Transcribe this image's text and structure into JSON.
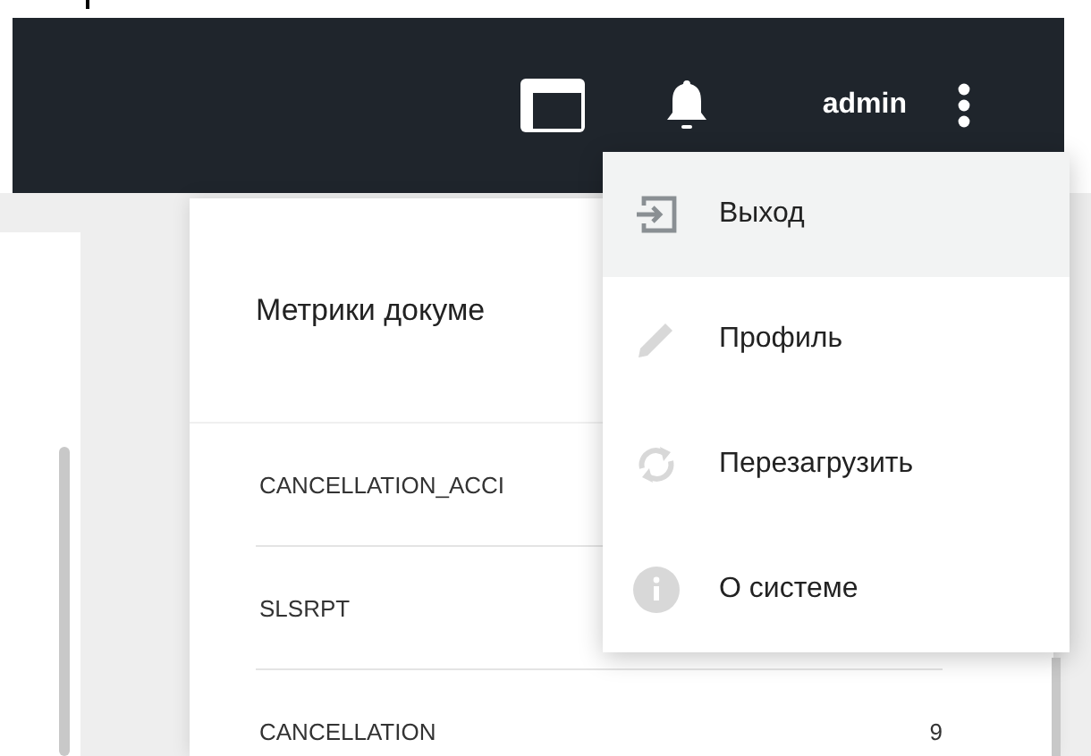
{
  "header": {
    "user": "admin"
  },
  "card": {
    "title": "Метрики докуме",
    "rows": [
      {
        "name": "CANCELLATION_ACCI"
      },
      {
        "name": "SLSRPT"
      },
      {
        "name": "CANCELLATION",
        "value": "9"
      }
    ]
  },
  "menu": {
    "items": [
      {
        "kind": "logout",
        "label": "Выход",
        "selected": true
      },
      {
        "kind": "edit",
        "label": "Профиль",
        "selected": false
      },
      {
        "kind": "reload",
        "label": "Перезагрузить",
        "selected": false
      },
      {
        "kind": "info",
        "label": "О системе",
        "selected": false
      }
    ]
  }
}
